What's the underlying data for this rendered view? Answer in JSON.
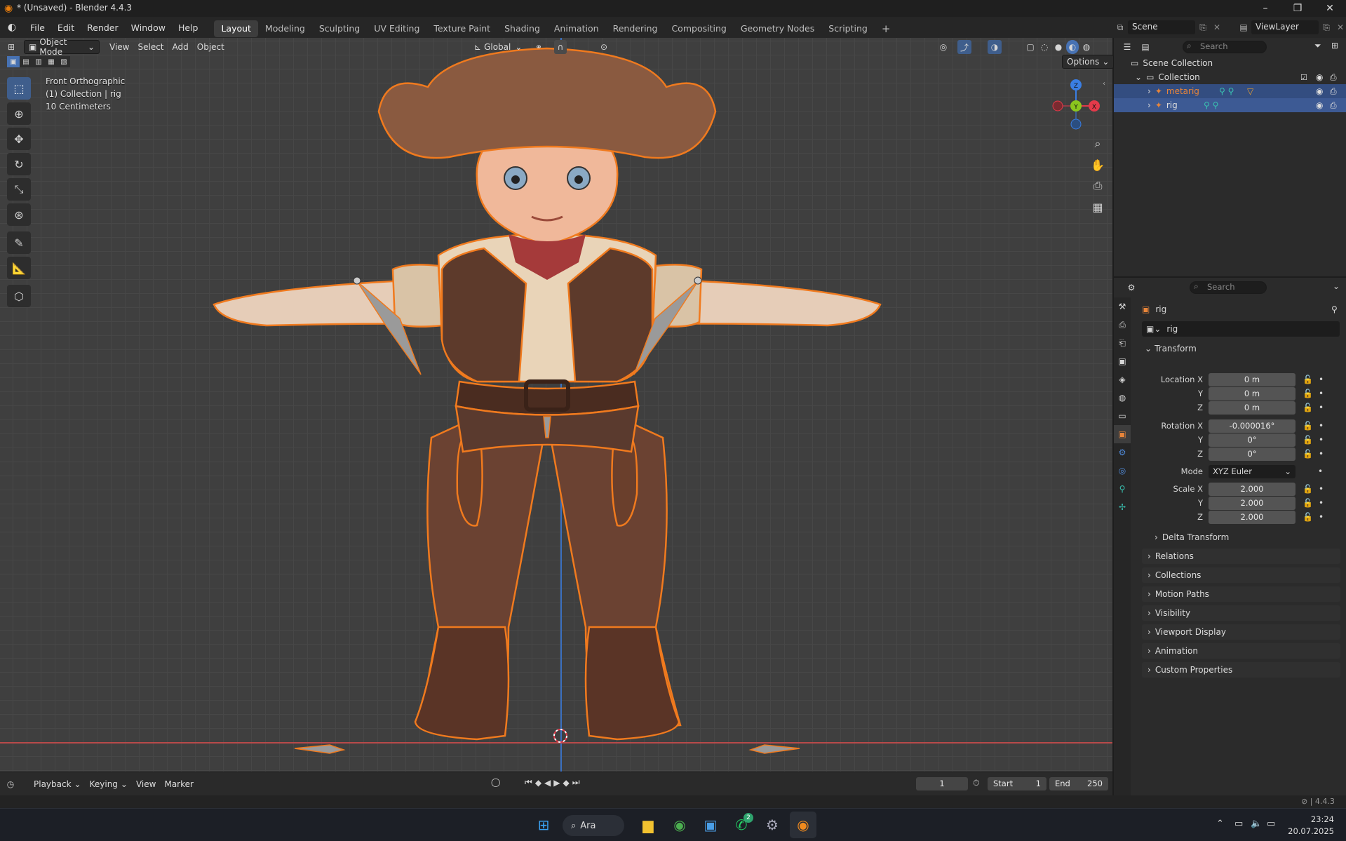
{
  "window": {
    "title": "* (Unsaved) - Blender 4.4.3",
    "controls": [
      "–",
      "❐",
      "✕"
    ]
  },
  "menus": [
    "File",
    "Edit",
    "Render",
    "Window",
    "Help"
  ],
  "workspaces": [
    {
      "label": "Layout",
      "active": true
    },
    {
      "label": "Modeling"
    },
    {
      "label": "Sculpting"
    },
    {
      "label": "UV Editing"
    },
    {
      "label": "Texture Paint"
    },
    {
      "label": "Shading"
    },
    {
      "label": "Animation"
    },
    {
      "label": "Rendering"
    },
    {
      "label": "Compositing"
    },
    {
      "label": "Geometry Nodes"
    },
    {
      "label": "Scripting"
    }
  ],
  "scene": {
    "name": "Scene",
    "view_layer": "ViewLayer"
  },
  "viewport_header": {
    "mode": "Object Mode",
    "menus": [
      "View",
      "Select",
      "Add",
      "Object"
    ],
    "orientation": "Global",
    "options_label": "Options"
  },
  "viewport_info": {
    "view": "Front Orthographic",
    "collection": "(1) Collection | rig",
    "scale": "10 Centimeters"
  },
  "gizmo": {
    "z": "Z",
    "y": "Y",
    "x": "X"
  },
  "tools": [
    "select-box",
    "cursor",
    "move",
    "rotate",
    "scale",
    "transform",
    "annotate",
    "measure",
    "add-cube"
  ],
  "timeline": {
    "menus": [
      "Playback",
      "Keying",
      "View",
      "Marker"
    ],
    "current_frame": "1",
    "start_label": "Start",
    "start": "1",
    "end_label": "End",
    "end": "250"
  },
  "outliner": {
    "search_placeholder": "Search",
    "scene_collection": "Scene Collection",
    "collection": "Collection",
    "items": [
      {
        "name": "metarig",
        "color": "#e8853a"
      },
      {
        "name": "rig",
        "color": "#dcdcdc"
      }
    ]
  },
  "properties": {
    "search_placeholder": "Search",
    "object_name": "rig",
    "data_name": "rig",
    "transform_label": "Transform",
    "location": {
      "label_x": "Location X",
      "label_y": "Y",
      "label_z": "Z",
      "x": "0 m",
      "y": "0 m",
      "z": "0 m"
    },
    "rotation": {
      "label_x": "Rotation X",
      "label_y": "Y",
      "label_z": "Z",
      "x": "-0.000016°",
      "y": "0°",
      "z": "0°"
    },
    "mode_label": "Mode",
    "mode": "XYZ Euler",
    "scale": {
      "label_x": "Scale X",
      "label_y": "Y",
      "label_z": "Z",
      "x": "2.000",
      "y": "2.000",
      "z": "2.000"
    },
    "delta_transform": "Delta Transform",
    "panels": [
      "Relations",
      "Collections",
      "Motion Paths",
      "Visibility",
      "Viewport Display",
      "Animation",
      "Custom Properties"
    ]
  },
  "status_bar": {
    "version": "4.4.3"
  },
  "taskbar": {
    "search_label": "Ara",
    "whatsapp_badge": "2",
    "time": "23:24",
    "date": "20.07.2025"
  },
  "colors": {
    "accent_blue": "#4772b3",
    "selection": "#e8853a",
    "axis_x": "#e33a4a",
    "axis_y": "#8bc61e",
    "axis_z": "#3a7ee3"
  }
}
